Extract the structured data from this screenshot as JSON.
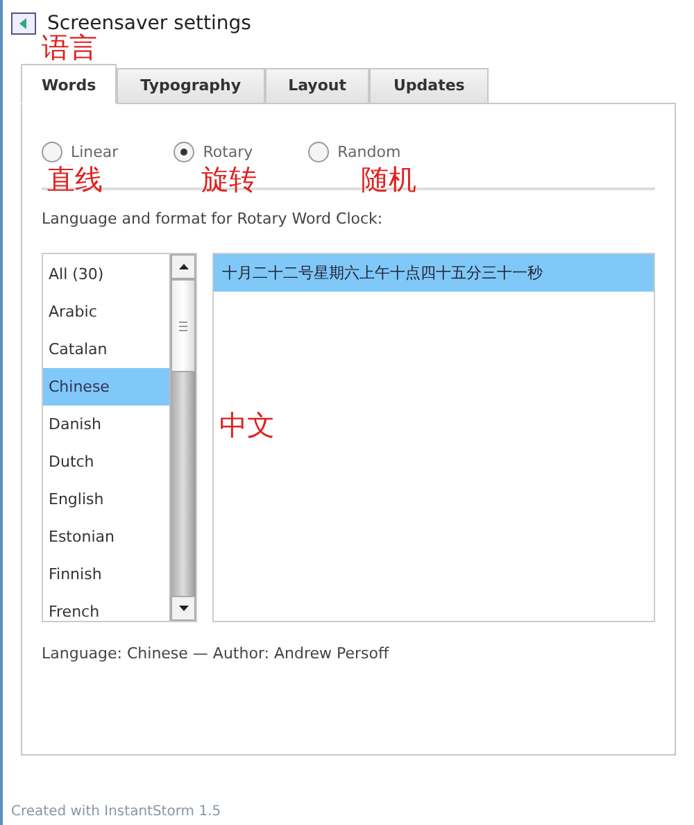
{
  "window": {
    "title": "Screensaver settings"
  },
  "tabs": [
    {
      "label": "Words",
      "selected": true
    },
    {
      "label": "Typography",
      "selected": false
    },
    {
      "label": "Layout",
      "selected": false
    },
    {
      "label": "Updates",
      "selected": false
    }
  ],
  "modes": [
    {
      "label": "Linear",
      "selected": false
    },
    {
      "label": "Rotary",
      "selected": true
    },
    {
      "label": "Random",
      "selected": false
    }
  ],
  "list_label": "Language and format for Rotary Word Clock:",
  "languages": [
    {
      "label": "All (30)",
      "selected": false
    },
    {
      "label": "Arabic",
      "selected": false
    },
    {
      "label": "Catalan",
      "selected": false
    },
    {
      "label": "Chinese",
      "selected": true
    },
    {
      "label": "Danish",
      "selected": false
    },
    {
      "label": "Dutch",
      "selected": false
    },
    {
      "label": "English",
      "selected": false
    },
    {
      "label": "Estonian",
      "selected": false
    },
    {
      "label": "Finnish",
      "selected": false
    },
    {
      "label": "French",
      "selected": false
    }
  ],
  "formats": [
    {
      "label": "十月二十二号星期六上午十点四十五分三十一秒",
      "selected": true
    }
  ],
  "footer": "Language: Chinese — Author: Andrew Persoff",
  "credit": "Created with InstantStorm 1.5",
  "annotations": [
    {
      "text": "语言"
    },
    {
      "text": "直线"
    },
    {
      "text": "旋转"
    },
    {
      "text": "随机"
    },
    {
      "text": "中文"
    }
  ]
}
